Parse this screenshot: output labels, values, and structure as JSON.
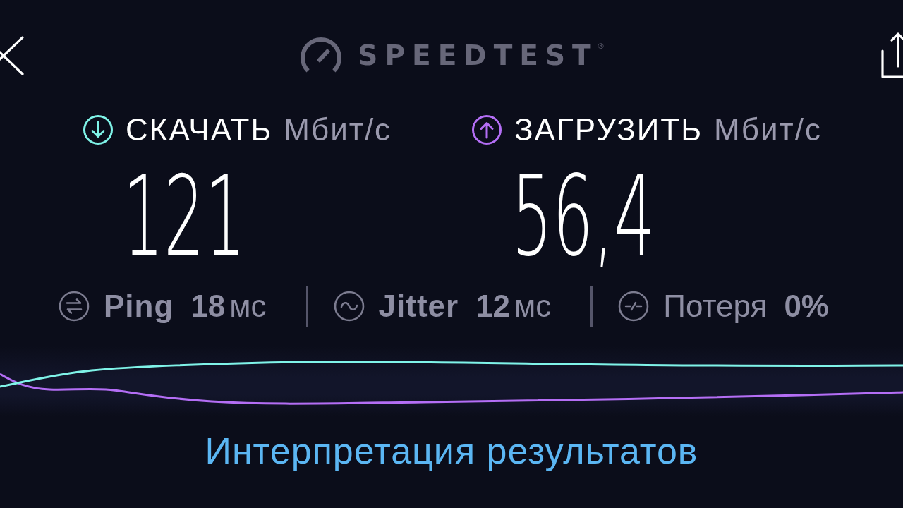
{
  "logo": {
    "text": "SPEEDTEST",
    "mark": "®"
  },
  "metrics": [
    {
      "kind": "download",
      "label": "СКАЧАТЬ",
      "unit": "Мбит/с",
      "value": "121",
      "color": "#7ff3e8"
    },
    {
      "kind": "upload",
      "label": "ЗАГРУЗИТЬ",
      "unit": "Мбит/с",
      "value": "56,4",
      "color": "#b46ef5"
    }
  ],
  "stats": [
    {
      "kind": "ping",
      "label": "Ping",
      "value": "18",
      "unit": "мс"
    },
    {
      "kind": "jitter",
      "label": "Jitter",
      "value": "12",
      "unit": "мс"
    },
    {
      "kind": "loss",
      "label": "Потеря",
      "value": "0%"
    }
  ],
  "link": "Интерпретация результатов"
}
